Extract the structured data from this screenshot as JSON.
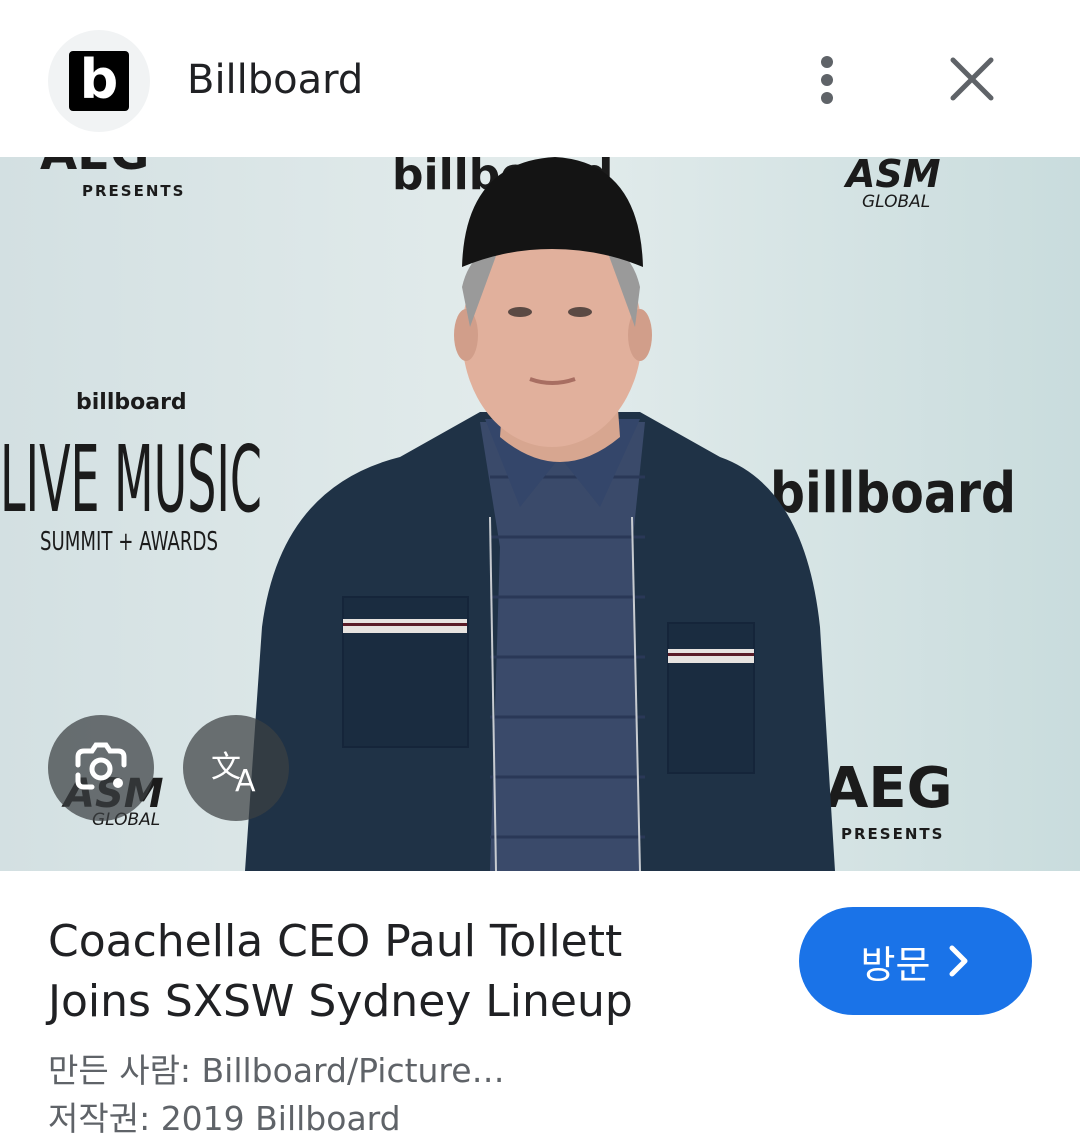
{
  "header": {
    "logo_letter": "b",
    "site_name": "Billboard",
    "more_icon": "more-vert-icon",
    "close_icon": "close-icon"
  },
  "image": {
    "backdrop_texts": {
      "aeg_top": "AEG",
      "presents_top": "PRESENTS",
      "billboard_top": "billboard",
      "asm_top": "ASM",
      "global_top": "GLOBAL",
      "billboard_small": "billboard",
      "live_music": "LIVE MUSIC",
      "summit_awards": "SUMMIT + AWARDS",
      "billboard_right": "billboard",
      "asm_bottom": "ASM",
      "global_bottom": "GLOBAL",
      "aeg_bottom": "AEG",
      "presents_bottom": "PRESENTS"
    },
    "lens_icon": "lens-camera-icon",
    "translate_icon": "translate-icon"
  },
  "caption": {
    "title_line1": "Coachella CEO Paul Tollett",
    "title_line2": "Joins SXSW Sydney Lineup",
    "visit_label": "방문",
    "visit_icon": "chevron-right-icon",
    "creator": "만든 사람: Billboard/Picture…",
    "copyright": "저작권: 2019 Billboard"
  },
  "colors": {
    "accent": "#1a73e8",
    "backdrop": "#d7e4e6"
  }
}
